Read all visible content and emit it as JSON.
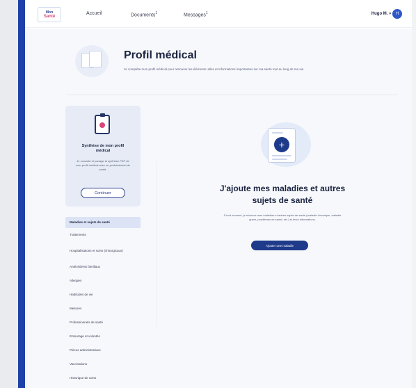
{
  "topbar": {
    "logo_line1": "Mon",
    "logo_line2": "Santé",
    "nav": [
      {
        "label": "Accueil",
        "badge": ""
      },
      {
        "label": "Documents",
        "badge": "1"
      },
      {
        "label": "Messages",
        "badge": "1"
      }
    ],
    "user_name": "Hugo M.",
    "user_chevron": "▾",
    "avatar_initial": "H"
  },
  "header": {
    "title": "Profil médical",
    "description": "Je complète mon profil médical pour retrouver les éléments utiles et informations importantes sur ma santé tout au long de ma vie."
  },
  "sidebar": {
    "card": {
      "title": "Synthèse de mon profil médical",
      "description": "Je consulte et partage la synthèse PDF de mon profil médical avec un professionnel de santé.",
      "button_label": "Continuer"
    },
    "items": [
      {
        "label": "Maladies et sujets de santé",
        "active": true
      },
      {
        "label": "Traitements",
        "active": false
      },
      {
        "label": "Hospitalisations et soins (chirurgicaux)",
        "active": false
      },
      {
        "label": "Antécédents familiaux",
        "active": false
      },
      {
        "label": "Allergies",
        "active": false
      },
      {
        "label": "Habitudes de vie",
        "active": false
      },
      {
        "label": "Mesures",
        "active": false
      },
      {
        "label": "Professionnels de santé",
        "active": false
      },
      {
        "label": "Entourage et volontés",
        "active": false
      },
      {
        "label": "Pièces administratives",
        "active": false
      },
      {
        "label": "Vaccinations",
        "active": false
      },
      {
        "label": "Historique de soins",
        "active": false
      }
    ]
  },
  "main": {
    "empty_title": "J'ajoute mes maladies et autres sujets de santé",
    "empty_description": "À tout moment, je retrouve mes maladies et autres sujets de santé (maladie chronique, maladie grave, problèmes de santé, etc.) et leurs informations.",
    "add_button_label": "Ajouter une maladie"
  },
  "colors": {
    "accent": "#1e3a8a",
    "left_bar": "#1e40a8",
    "card_bg": "#e6ebf6",
    "page_bg": "#f6f8fc"
  }
}
